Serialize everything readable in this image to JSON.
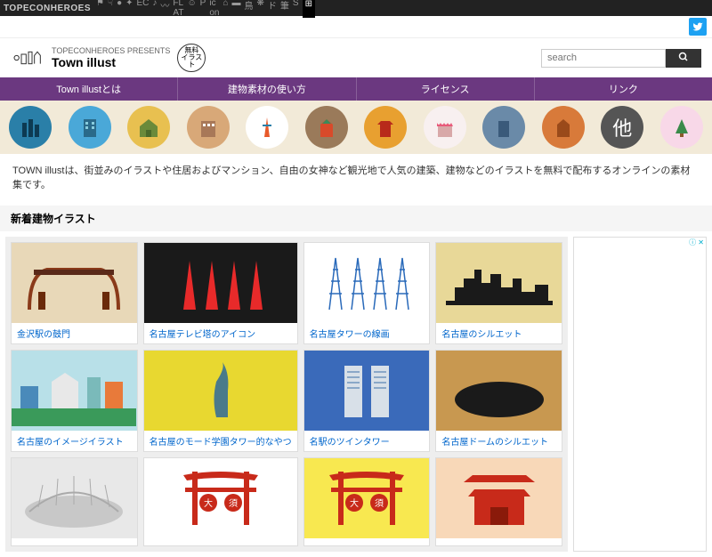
{
  "topbar": {
    "brand": "TOPECONHEROES"
  },
  "header": {
    "presents": "TOPECONHEROES PRESENTS",
    "site_name": "Town illust",
    "badge": "無料\nイラスト"
  },
  "search": {
    "placeholder": "search"
  },
  "nav": [
    "Town illustとは",
    "建物素材の使い方",
    "ライセンス",
    "リンク"
  ],
  "cat_other": "他",
  "description": "TOWN illustは、街並みのイラストや住居およびマンション、自由の女神など観光地で人気の建築、建物などのイラストを無料で配布するオンラインの素材集です。",
  "section_title": "新着建物イラスト",
  "items": [
    {
      "title": "金沢駅の鼓門"
    },
    {
      "title": "名古屋テレビ塔のアイコン"
    },
    {
      "title": "名古屋タワーの線画"
    },
    {
      "title": "名古屋のシルエット"
    },
    {
      "title": "名古屋のイメージイラスト"
    },
    {
      "title": "名古屋のモード学園タワー的なやつ"
    },
    {
      "title": "名駅のツインタワー"
    },
    {
      "title": "名古屋ドームのシルエット"
    },
    {
      "title": ""
    },
    {
      "title": ""
    },
    {
      "title": ""
    },
    {
      "title": ""
    }
  ],
  "ad": {
    "label": "ⓘ ✕"
  }
}
